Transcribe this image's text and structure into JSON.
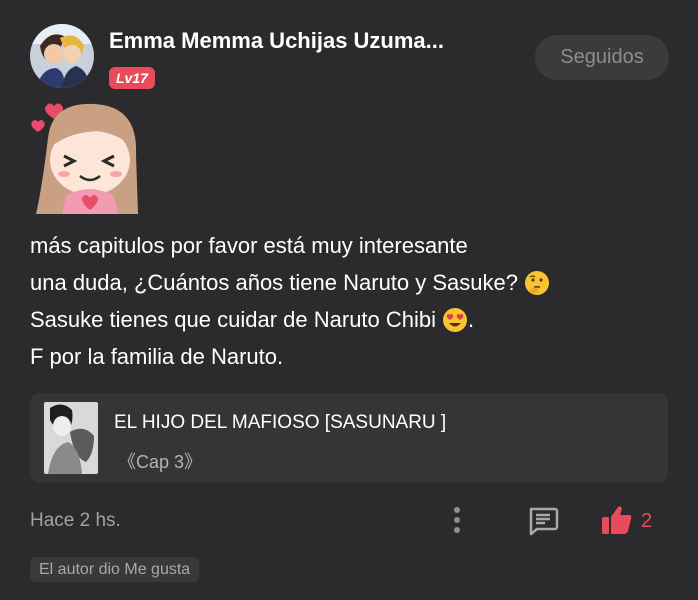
{
  "user": {
    "name": "Emma Memma Uchijas Uzuma...",
    "level": "Lv17",
    "follow_label": "Seguidos"
  },
  "comment": {
    "line1": "más capitulos por favor está muy interesante",
    "line2": "una duda, ¿Cuántos años tiene Naruto y Sasuke?",
    "line2_emoji": "thinking-face-icon",
    "line3": "Sasuke tienes que cuidar de Naruto Chibi",
    "line3_emoji": "heart-eyes-icon",
    "line3_end": ".",
    "line4": "F por la familia de Naruto."
  },
  "story": {
    "title": "EL HIJO DEL MAFIOSO [SASUNARU ]",
    "chapter": "《Cap 3》"
  },
  "footer": {
    "time": "Hace 2 hs.",
    "like_count": "2",
    "author_liked": "El autor dio Me gusta"
  },
  "colors": {
    "background": "#2b2b2d",
    "accent": "#e94b5b",
    "card": "#353537",
    "muted_text": "#a2a2a5"
  }
}
